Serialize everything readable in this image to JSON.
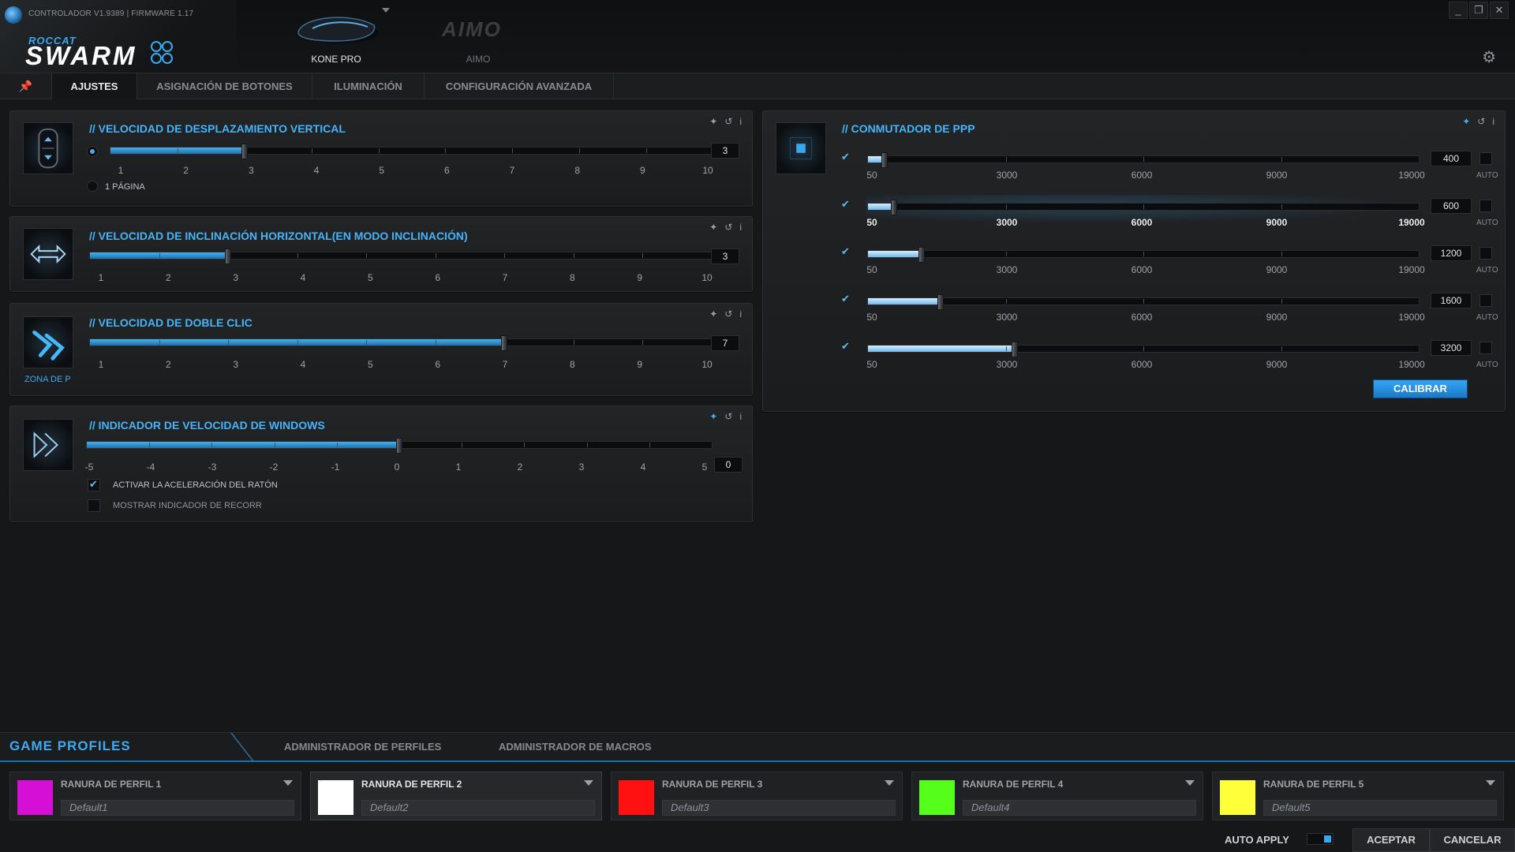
{
  "header": {
    "version": "CONTROLADOR V1.9389 | FIRMWARE 1.17",
    "brand_small": "ROCCAT",
    "brand_big": "SWARM",
    "devices": [
      {
        "name": "KONE PRO",
        "logo": "KONE PRO mouse image",
        "active": true
      },
      {
        "name": "AIMO",
        "logo": "AIMO",
        "active": false
      }
    ],
    "window_controls": [
      "minimize-icon",
      "restore-icon",
      "close-icon"
    ]
  },
  "tabs": [
    {
      "label": "",
      "icon": "pin-icon"
    },
    {
      "label": "AJUSTES",
      "active": true
    },
    {
      "label": "ASIGNACIÓN DE BOTONES"
    },
    {
      "label": "ILUMINACIÓN"
    },
    {
      "label": "CONFIGURACIÓN AVANZADA"
    }
  ],
  "panels": {
    "vertical": {
      "title": "// VELOCIDAD DE DESPLAZAMIENTO VERTICAL",
      "ticks": [
        "1",
        "2",
        "3",
        "4",
        "5",
        "6",
        "7",
        "8",
        "9",
        "10"
      ],
      "value": "3",
      "level": 3,
      "radio_line_selected": true,
      "radio_page_label": "1 PÁGINA"
    },
    "horizontal": {
      "title": "// VELOCIDAD DE INCLINACIÓN HORIZONTAL(EN MODO INCLINACIÓN)",
      "ticks": [
        "1",
        "2",
        "3",
        "4",
        "5",
        "6",
        "7",
        "8",
        "9",
        "10"
      ],
      "value": "3",
      "level": 3
    },
    "doubleclick": {
      "title": "// VELOCIDAD DE DOBLE CLIC",
      "ticks": [
        "1",
        "2",
        "3",
        "4",
        "5",
        "6",
        "7",
        "8",
        "9",
        "10"
      ],
      "value": "7",
      "level": 7,
      "zone_label": "ZONA DE P"
    },
    "windows": {
      "title": "// INDICADOR DE VELOCIDAD DE WINDOWS",
      "ticks": [
        "-5",
        "-4",
        "-3",
        "-2",
        "-1",
        "0",
        "1",
        "2",
        "3",
        "4",
        "5"
      ],
      "value": "0",
      "level": 0,
      "accel_label": "ACTIVAR LA ACELERACIÓN DEL RATÓN",
      "accel_checked": true,
      "trail_label": "MOSTRAR INDICADOR DE RECORR",
      "trail_checked": false
    },
    "dpi": {
      "title": "// CONMUTADOR DE PPP",
      "ticks": [
        "50",
        "3000",
        "6000",
        "9000",
        "19000"
      ],
      "auto_label": "AUTO",
      "calibrate_label": "CALIBRAR",
      "levels": [
        {
          "value": "400",
          "dpi": 400,
          "checked": true,
          "selected": false
        },
        {
          "value": "600",
          "dpi": 600,
          "checked": true,
          "selected": true
        },
        {
          "value": "1200",
          "dpi": 1200,
          "checked": true,
          "selected": false
        },
        {
          "value": "1600",
          "dpi": 1600,
          "checked": true,
          "selected": false
        },
        {
          "value": "3200",
          "dpi": 3200,
          "checked": true,
          "selected": false
        }
      ]
    }
  },
  "game_profiles": {
    "title": "GAME PROFILES",
    "tabs": [
      "ADMINISTRADOR DE PERFILES",
      "ADMINISTRADOR DE MACROS"
    ],
    "slots": [
      {
        "name": "RANURA DE PERFIL 1",
        "profile": "Default1",
        "color": "#d50fd6",
        "selected": false
      },
      {
        "name": "RANURA DE PERFIL 2",
        "profile": "Default2",
        "color": "#ffffff",
        "selected": true
      },
      {
        "name": "RANURA DE PERFIL 3",
        "profile": "Default3",
        "color": "#ff1111",
        "selected": false
      },
      {
        "name": "RANURA DE PERFIL 4",
        "profile": "Default4",
        "color": "#55ff1a",
        "selected": false
      },
      {
        "name": "RANURA DE PERFIL 5",
        "profile": "Default5",
        "color": "#ffff3a",
        "selected": false
      }
    ]
  },
  "footer": {
    "auto_apply_label": "AUTO APPLY",
    "auto_apply_on": true,
    "accept_label": "ACEPTAR",
    "cancel_label": "CANCELAR"
  }
}
